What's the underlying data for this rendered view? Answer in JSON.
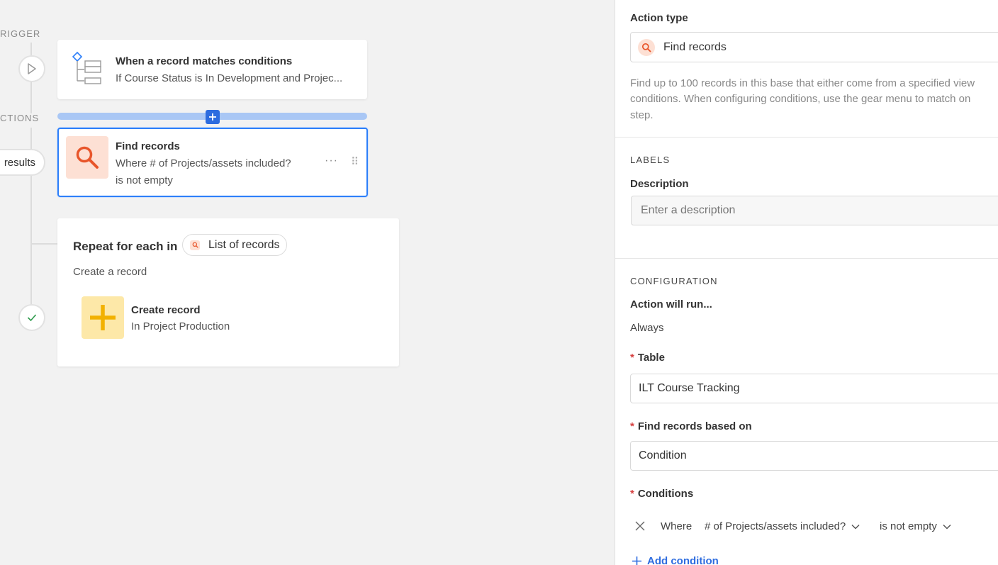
{
  "canvas": {
    "trigger_label": "RIGGER",
    "actions_label": "CTIONS",
    "results_label": "results",
    "trigger": {
      "title": "When a record matches conditions",
      "subtitle": "If Course Status is In Development and Projec..."
    },
    "find": {
      "title": "Find records",
      "subtitle_line1": "Where # of Projects/assets included?",
      "subtitle_line2": "is not empty",
      "more": "···",
      "drag": "⠿"
    },
    "repeat": {
      "title": "Repeat for each in",
      "pill_label": "List of records",
      "subtitle": "Create a record",
      "create_title": "Create record",
      "create_subtitle": "In Project Production"
    }
  },
  "panel": {
    "action_type_label": "Action type",
    "action_type_value": "Find records",
    "description_text_1": "Find up to 100 records in this base that either come from a specified view",
    "description_text_2": "conditions. When configuring conditions, use the gear menu to match on",
    "description_text_3": "step.",
    "labels_section": "LABELS",
    "description_label": "Description",
    "description_placeholder": "Enter a description",
    "configuration_section": "CONFIGURATION",
    "action_will_run_label": "Action will run...",
    "action_will_run_value": "Always",
    "table_label": "Table",
    "table_value": "ILT Course Tracking",
    "find_based_label": "Find records based on",
    "find_based_value": "Condition",
    "conditions_label": "Conditions",
    "condition": {
      "where": "Where",
      "field": "# of Projects/assets included?",
      "operator": "is not empty"
    },
    "add_condition": "Add condition"
  },
  "colors": {
    "accent_blue": "#2d7ff9",
    "find_tile": "#fde0d4",
    "find_icon": "#e8552a",
    "create_tile": "#fde8a8",
    "create_icon": "#f2b100",
    "required": "#d64141"
  }
}
